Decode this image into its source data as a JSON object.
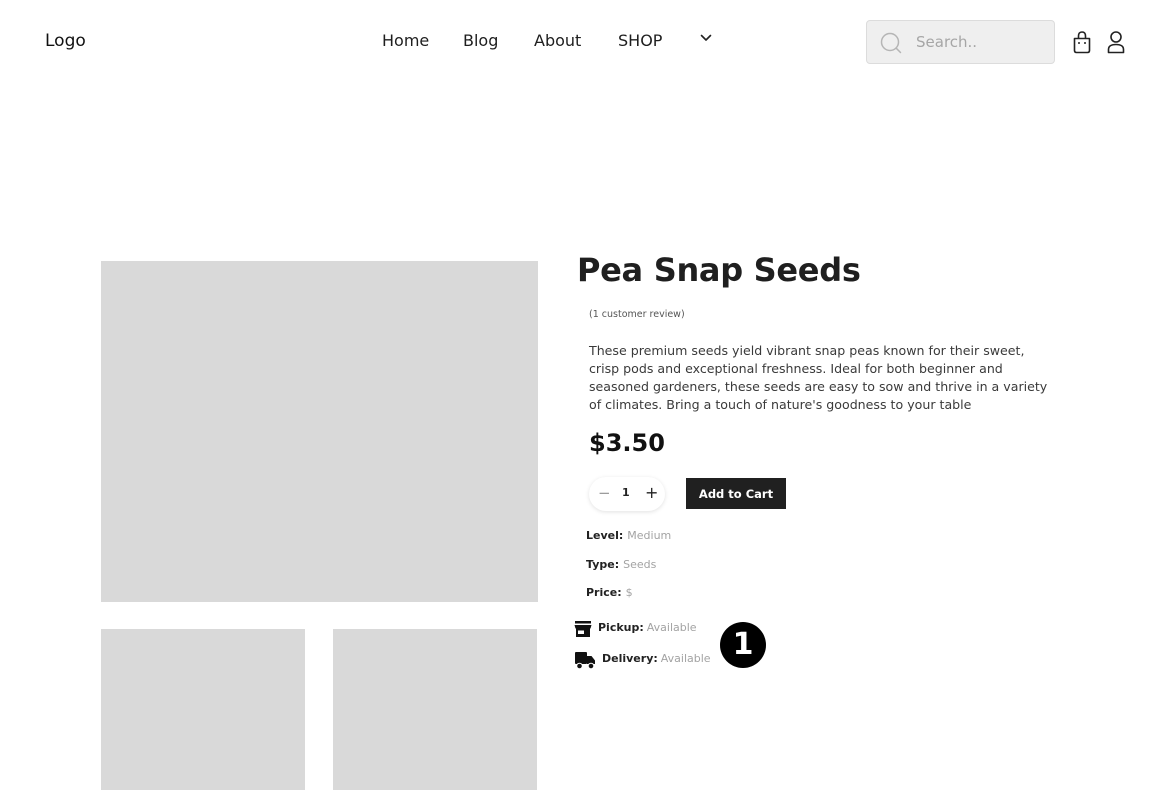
{
  "header": {
    "logo": "Logo",
    "nav": {
      "home": "Home",
      "blog": "Blog",
      "about": "About",
      "shop": "SHOP"
    },
    "search": {
      "placeholder": "Search.."
    }
  },
  "product": {
    "title": "Pea Snap Seeds",
    "reviews": "(1 customer review)",
    "description": "These premium seeds yield vibrant snap peas known for their sweet, crisp pods and exceptional freshness. Ideal for both beginner and seasoned gardeners, these seeds are easy to sow and thrive in a variety of climates. Bring a touch of nature's goodness to your table",
    "price": "$3.50",
    "quantity": "1",
    "add_to_cart": "Add to Cart",
    "attributes": {
      "level": {
        "label": "Level:",
        "value": "Medium"
      },
      "type": {
        "label": "Type:",
        "value": "Seeds"
      },
      "price": {
        "label": "Price:",
        "value": "$"
      }
    },
    "availability": {
      "pickup": {
        "label": "Pickup:",
        "value": "Available"
      },
      "delivery": {
        "label": "Delivery:",
        "value": "Available"
      }
    }
  },
  "annotation": {
    "marker": "1"
  },
  "icons": {
    "search": "search-icon",
    "cart": "shopping-bag-icon",
    "user": "user-icon",
    "chevron": "chevron-down-icon",
    "minus": "minus-icon",
    "plus": "plus-icon",
    "store": "store-icon",
    "truck": "truck-icon"
  },
  "colors": {
    "button_bg": "#202020",
    "placeholder_image": "#d9d9d9",
    "muted_text": "#a3a3a3",
    "search_bg": "#efefef"
  }
}
